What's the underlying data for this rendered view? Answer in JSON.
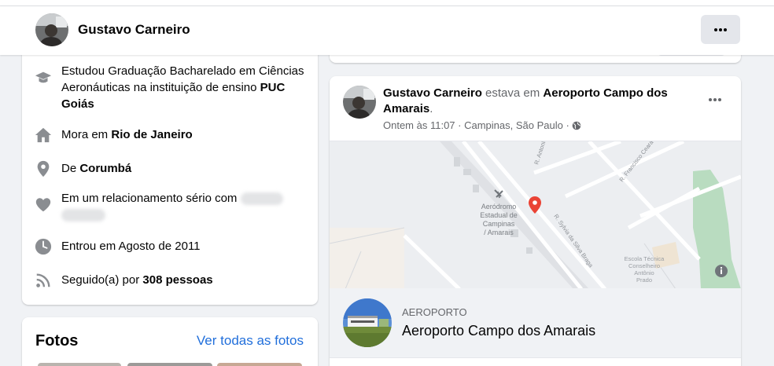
{
  "header": {
    "name": "Gustavo Carneiro",
    "more_icon": "more-horizontal-icon"
  },
  "intro": {
    "education": {
      "icon": "graduation-cap-icon",
      "prefix": "Estudou Graduação Bacharelado em Ciências Aeronáuticas na instituição de ensino ",
      "school": "PUC Goiás"
    },
    "lives": {
      "icon": "home-icon",
      "prefix": "Mora em ",
      "city": "Rio de Janeiro"
    },
    "from": {
      "icon": "location-pin-icon",
      "prefix": "De ",
      "city": "Corumbá"
    },
    "relationship": {
      "icon": "heart-icon",
      "prefix": "Em um relacionamento sério com "
    },
    "joined": {
      "icon": "clock-icon",
      "text": "Entrou em Agosto de 2011"
    },
    "followers": {
      "icon": "rss-icon",
      "prefix": "Seguido(a) por ",
      "count": "308 pessoas"
    }
  },
  "photos": {
    "title": "Fotos",
    "see_all": "Ver todas as fotos"
  },
  "post": {
    "author": "Gustavo Carneiro",
    "verb": " estava em ",
    "place": "Aeroporto Campo dos Amarais",
    "end": ".",
    "time": "Ontem às 11:07",
    "separator": " · ",
    "location": "Campinas, São Paulo",
    "audience_icon": "globe-icon",
    "map": {
      "airport_label_1": "Aeródromo",
      "airport_label_2": "Estadual de",
      "airport_label_3": "Campinas",
      "airport_label_4": "/ Amarais",
      "street_1": "R. Antonio",
      "street_2": "R. Francisco Ceará B",
      "street_3": "R. Sylvia da Silva Braga",
      "school_1": "Escola Técnica",
      "school_2": "Conselheiro",
      "school_3": "Antônio",
      "school_4": "Prado",
      "info_icon": "info-icon",
      "pin_icon": "map-pin-icon"
    },
    "place_card": {
      "category": "AEROPORTO",
      "name": "Aeroporto Campo dos Amarais"
    }
  }
}
